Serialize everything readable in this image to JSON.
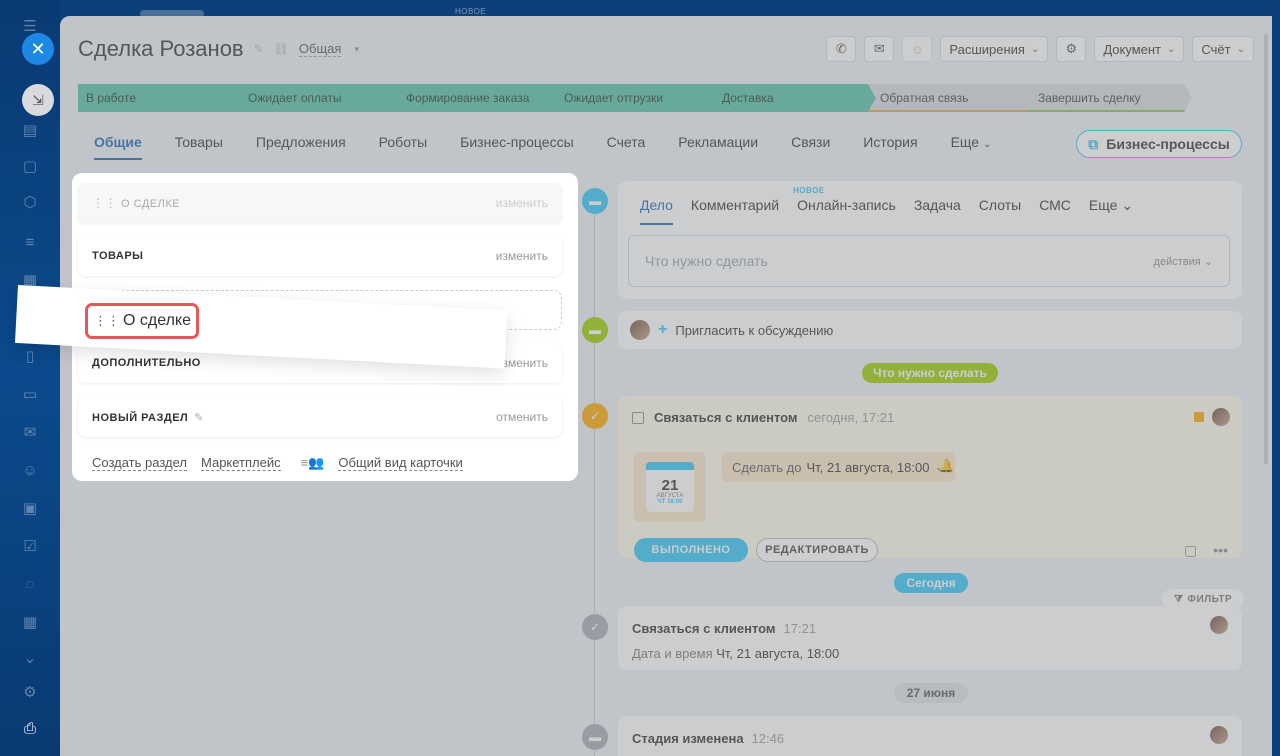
{
  "top_strip": {
    "new_label": "НОВОЕ"
  },
  "deal": {
    "title": "Сделка Розанов",
    "category": "Общая"
  },
  "header_buttons": {
    "extensions": "Расширения",
    "document": "Документ",
    "invoice": "Счёт"
  },
  "stages": [
    {
      "label": "В работе",
      "state": "done"
    },
    {
      "label": "Ожидает оплаты",
      "state": "done"
    },
    {
      "label": "Формирование заказа",
      "state": "done"
    },
    {
      "label": "Ожидает отгрузки",
      "state": "done"
    },
    {
      "label": "Доставка",
      "state": "done"
    },
    {
      "label": "Обратная связь",
      "state": "todo"
    },
    {
      "label": "Завершить сделку",
      "state": "todo"
    }
  ],
  "tabs": [
    {
      "label": "Общие",
      "active": true
    },
    {
      "label": "Товары"
    },
    {
      "label": "Предложения"
    },
    {
      "label": "Роботы"
    },
    {
      "label": "Бизнес-процессы"
    },
    {
      "label": "Счета"
    },
    {
      "label": "Рекламации"
    },
    {
      "label": "Связи"
    },
    {
      "label": "История"
    },
    {
      "label": "Еще"
    }
  ],
  "bp_button": "Бизнес-процессы",
  "sections": {
    "about": {
      "label": "О СДЕЛКЕ",
      "action": "изменить"
    },
    "products": {
      "label": "ТОВАРЫ",
      "action": "изменить"
    },
    "additional": {
      "label": "ДОПОЛНИТЕЛЬНО",
      "action": "изменить"
    },
    "new_section": {
      "label": "НОВЫЙ РАЗДЕЛ",
      "action": "отменить"
    }
  },
  "drag_label": "О сделке",
  "footer_links": {
    "create": "Создать раздел",
    "market": "Маркетплейс",
    "view": "Общий вид карточки"
  },
  "activity": {
    "tabs": [
      "Дело",
      "Комментарий",
      "Онлайн-запись",
      "Задача",
      "Слоты",
      "СМС",
      "Еще"
    ],
    "new_badge": "НОВОЕ",
    "placeholder": "Что нужно сделать",
    "actions": "действия"
  },
  "invite": "Пригласить к обсуждению",
  "todo_pill": "Что нужно сделать",
  "task": {
    "title": "Связаться с клиентом",
    "time": "сегодня, 17:21",
    "cal_day": "21",
    "cal_month": "АВГУСТА",
    "cal_week": "ЧТ 18:00",
    "due_prefix": "Сделать до",
    "due_value": "Чт, 21 августа, 18:00",
    "done_btn": "ВЫПОЛНЕНО",
    "edit_btn": "РЕДАКТИРОВАТЬ"
  },
  "today_pill": "Сегодня",
  "filter": "ФИЛЬТР",
  "history": [
    {
      "title": "Связаться с клиентом",
      "time": "17:21",
      "line_prefix": "Дата и время",
      "line_value": "Чт, 21 августа, 18:00"
    }
  ],
  "date_pill": "27 июня",
  "stage_changed": {
    "title": "Стадия изменена",
    "time": "12:46"
  }
}
